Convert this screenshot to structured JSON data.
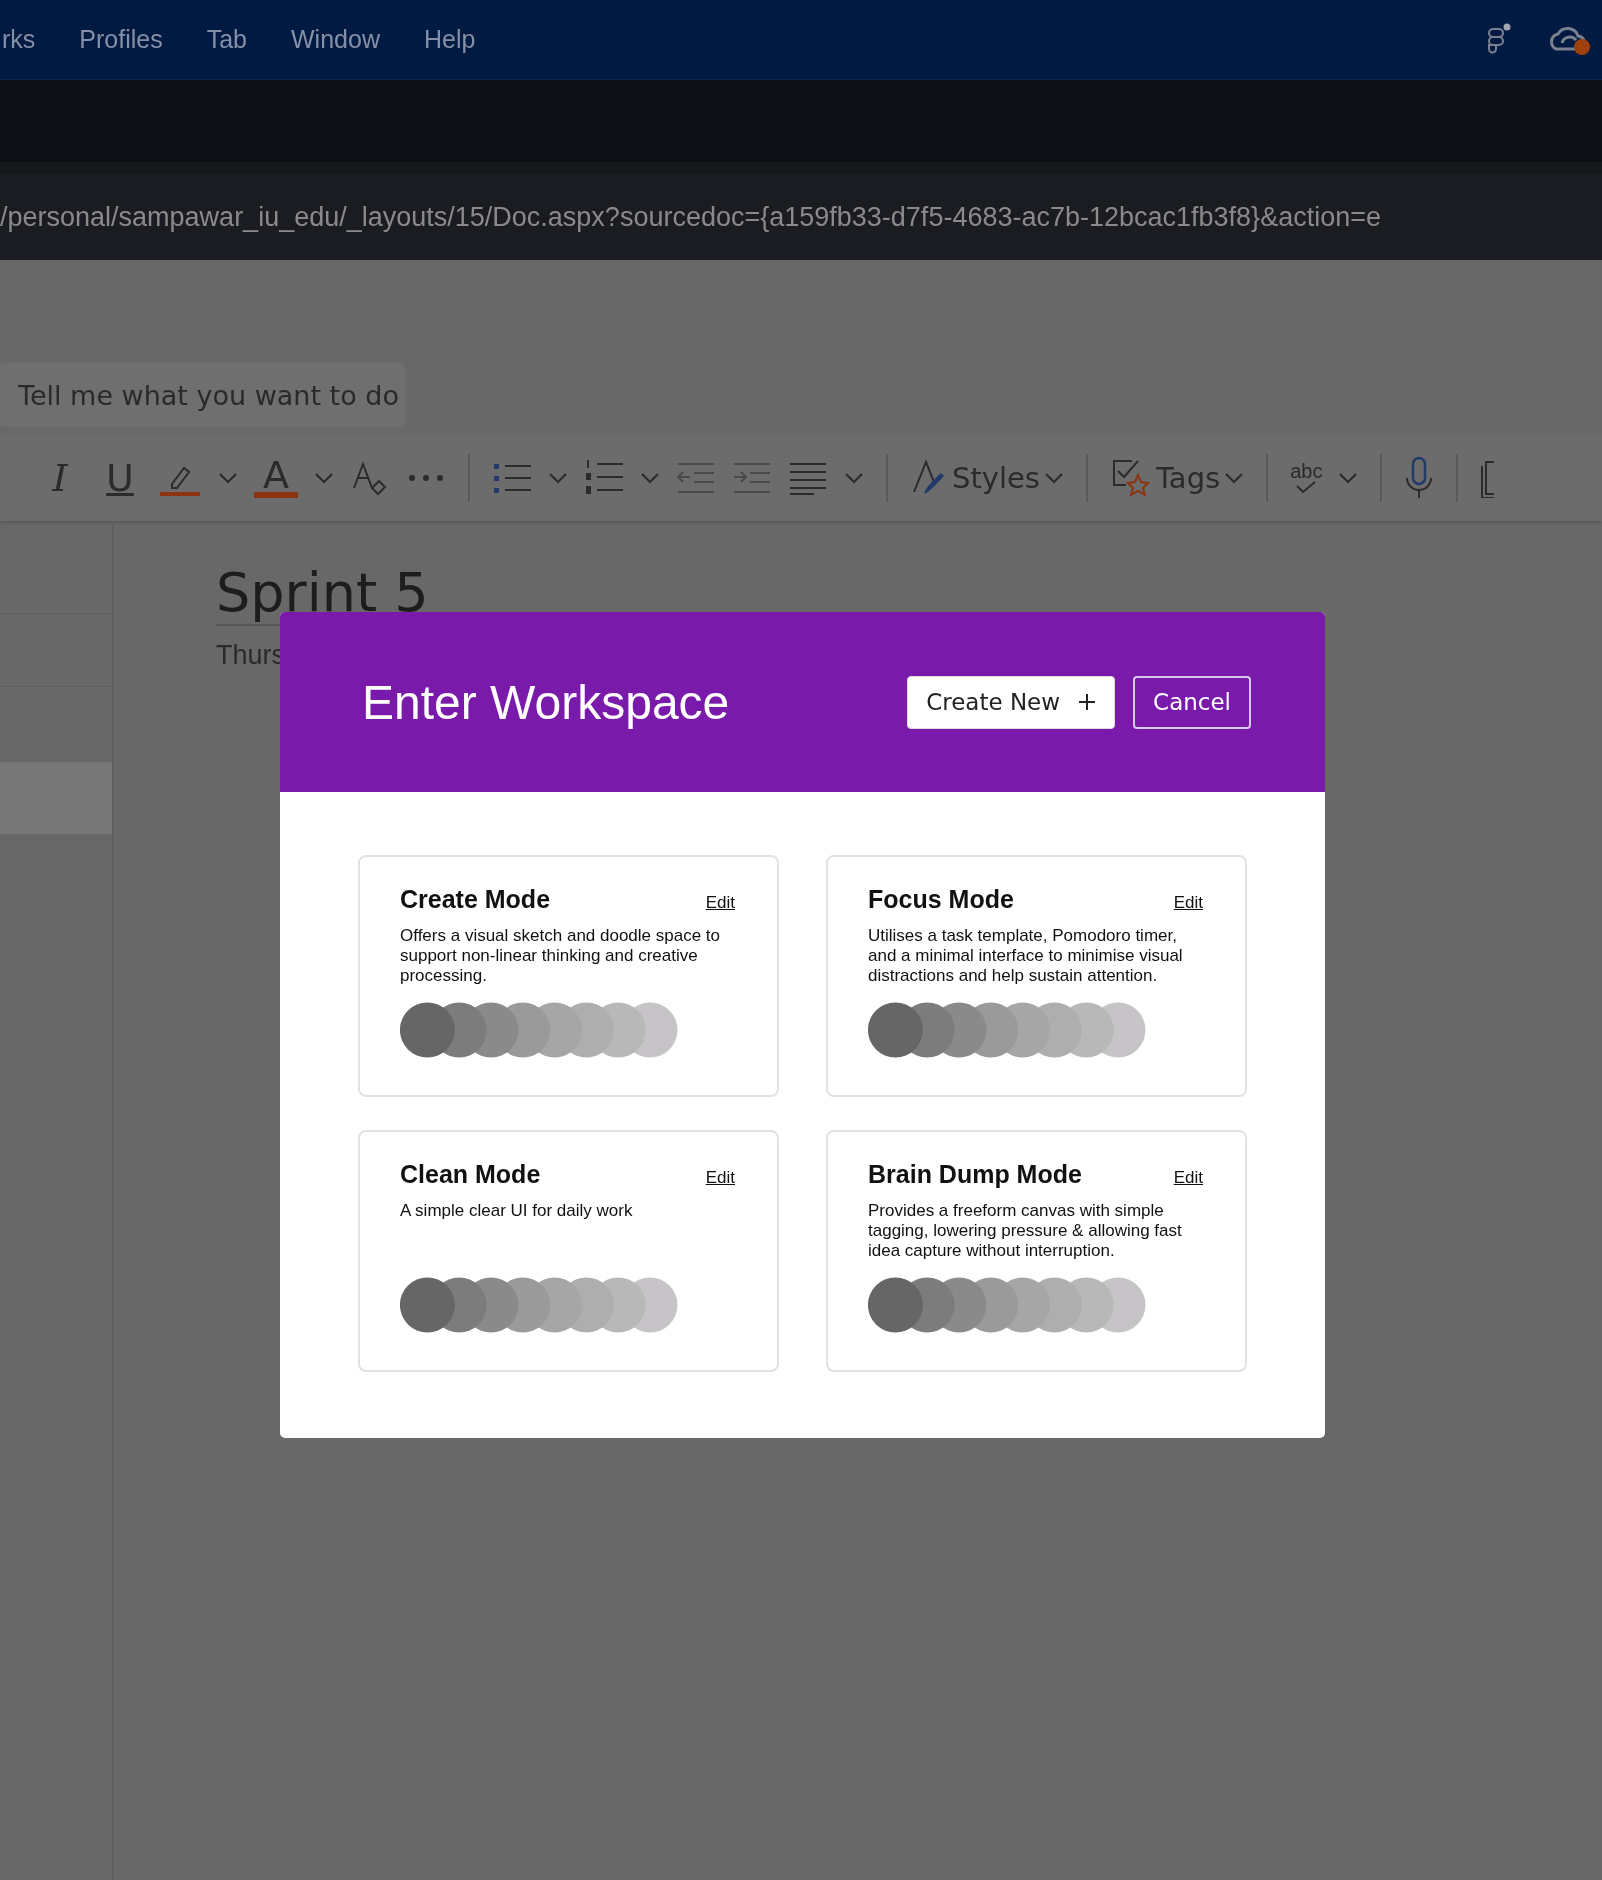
{
  "menu_bar": {
    "items": [
      "rks",
      "Profiles",
      "Tab",
      "Window",
      "Help"
    ]
  },
  "address_bar": {
    "url": "/personal/sampawar_iu_edu/_layouts/15/Doc.aspx?sourcedoc={a159fb33-d7f5-4683-ac7b-12bcac1fb3f8}&action=e"
  },
  "search": {
    "placeholder": "Tell me what you want to do"
  },
  "toolbar": [
    {
      "kind": "italic",
      "label": "I"
    },
    {
      "kind": "underline",
      "label": "U"
    },
    {
      "kind": "highlight"
    },
    {
      "kind": "dropdown"
    },
    {
      "kind": "font-color",
      "label": "A"
    },
    {
      "kind": "dropdown"
    },
    {
      "kind": "clear-format"
    },
    {
      "kind": "more"
    },
    {
      "kind": "separator"
    },
    {
      "kind": "bullets"
    },
    {
      "kind": "dropdown"
    },
    {
      "kind": "numbering"
    },
    {
      "kind": "dropdown"
    },
    {
      "kind": "outdent"
    },
    {
      "kind": "indent"
    },
    {
      "kind": "align"
    },
    {
      "kind": "dropdown"
    },
    {
      "kind": "separator"
    },
    {
      "kind": "styles",
      "label": "Styles"
    },
    {
      "kind": "separator"
    },
    {
      "kind": "tags",
      "label": "Tags"
    },
    {
      "kind": "separator"
    },
    {
      "kind": "spelling",
      "label": "abc"
    },
    {
      "kind": "dropdown"
    },
    {
      "kind": "separator"
    },
    {
      "kind": "dictate"
    },
    {
      "kind": "separator"
    },
    {
      "kind": "page"
    }
  ],
  "sidebar": {
    "items": [
      {
        "selected": false
      },
      {
        "selected": false
      },
      {
        "selected": true
      }
    ]
  },
  "document": {
    "title": "Sprint 5",
    "date": "Thurs"
  },
  "dialog": {
    "title": "Enter Workspace",
    "buttons": [
      {
        "label": "Create New",
        "kind": "primary"
      },
      {
        "label": "Cancel",
        "kind": "outline"
      }
    ],
    "modes": [
      {
        "title": "Create Mode",
        "link": "Edit",
        "description": "Offers a visual sketch and doodle space to support non-linear thinking and creative processing."
      },
      {
        "title": "Focus Mode",
        "link": "Edit",
        "description": "Utilises a task template, Pomodoro timer, and a minimal interface to minimise visual distractions and help sustain attention."
      },
      {
        "title": "Clean Mode",
        "link": "Edit",
        "description": "A simple clear UI for daily work"
      },
      {
        "title": "Brain Dump Mode",
        "link": "Edit",
        "description": "Provides a freeform canvas with simple tagging, lowering pressure & allowing fast idea capture without interruption."
      }
    ]
  }
}
